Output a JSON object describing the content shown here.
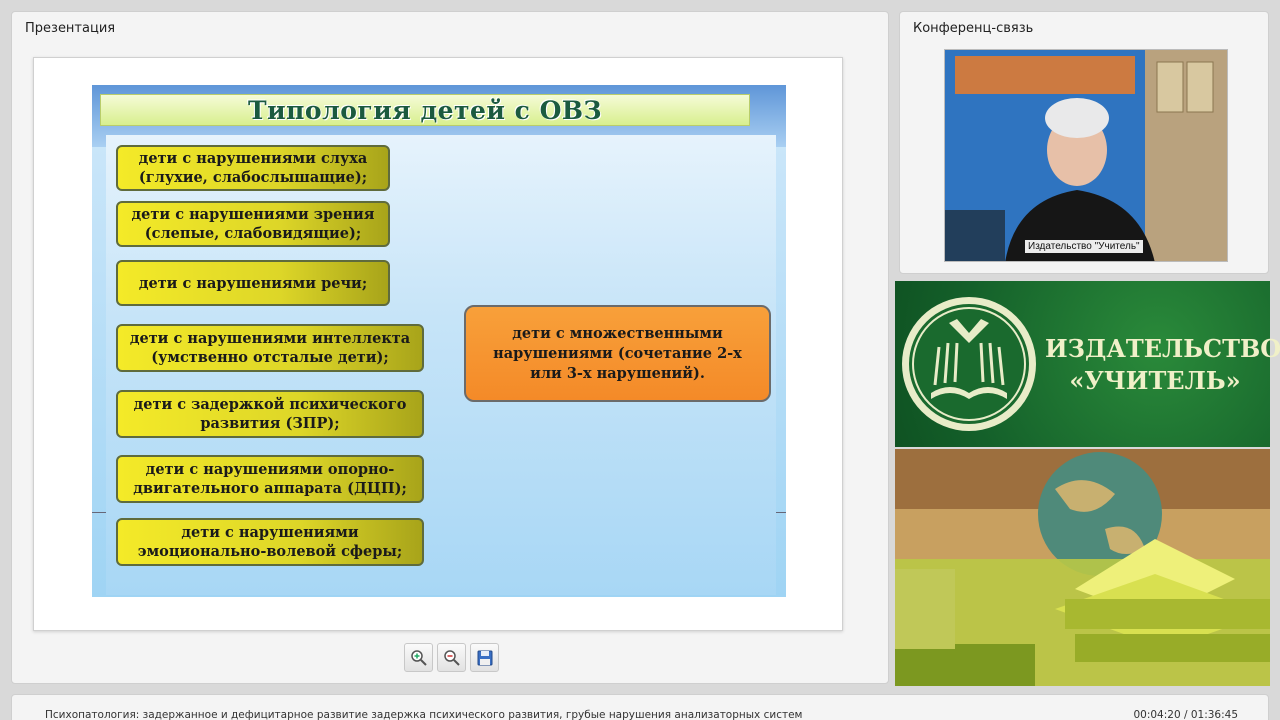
{
  "presentation_panel": {
    "title": "Презентация"
  },
  "conference_panel": {
    "title": "Конференц-связь",
    "video_caption": "Издательство \"Учитель\""
  },
  "slide": {
    "title": "Типология детей с ОВЗ",
    "left_items": [
      "дети с нарушениями слуха (глухие, слабослышащие);",
      "дети с нарушениями зрения (слепые, слабовидящие);",
      "дети с нарушениями речи;",
      "дети с нарушениями интеллекта (умственно отсталые дети);",
      "дети с задержкой психического развития (ЗПР);",
      "дети с нарушениями опорно-двигательного аппарата (ДЦП);",
      "дети с нарушениями эмоционально-волевой сферы;"
    ],
    "right_item": "дети с множественными нарушениями (сочетание 2-х или 3-х нарушений)."
  },
  "toolbar": {
    "zoom_in_icon": "zoom-in-icon",
    "zoom_out_icon": "zoom-out-icon",
    "save_icon": "floppy-disk-icon"
  },
  "banner": {
    "line1": "ИЗДАТЕЛЬСТВО",
    "line2": "«УЧИТЕЛЬ»"
  },
  "status": {
    "lecture_title": "Психопатология: задержанное и дефицитарное развитие задержка психического развития, грубые нарушения анализаторных систем",
    "time": "00:04:20 / 01:36:45"
  },
  "colors": {
    "slide_yellow": "#f4ea28",
    "slide_orange": "#f48a28",
    "banner_green": "#14602a"
  }
}
